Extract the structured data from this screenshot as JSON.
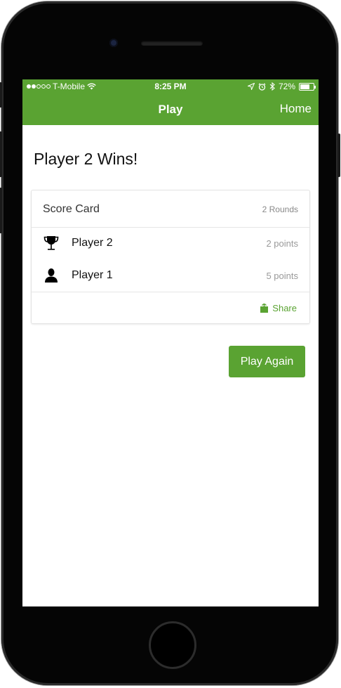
{
  "status_bar": {
    "carrier": "T-Mobile",
    "time": "8:25 PM",
    "battery": "72%",
    "battery_level": 0.72,
    "signal_bars_filled": 2,
    "signal_bars_total": 5
  },
  "nav": {
    "title": "Play",
    "home_label": "Home"
  },
  "result": {
    "headline": "Player 2 Wins!"
  },
  "score_card": {
    "title": "Score Card",
    "rounds": "2 Rounds",
    "players": [
      {
        "name": "Player 2",
        "points": "2 points",
        "icon": "trophy-icon"
      },
      {
        "name": "Player 1",
        "points": "5 points",
        "icon": "person-icon"
      }
    ],
    "share_label": "Share"
  },
  "actions": {
    "play_again_label": "Play Again"
  },
  "colors": {
    "accent": "#5aa332"
  }
}
